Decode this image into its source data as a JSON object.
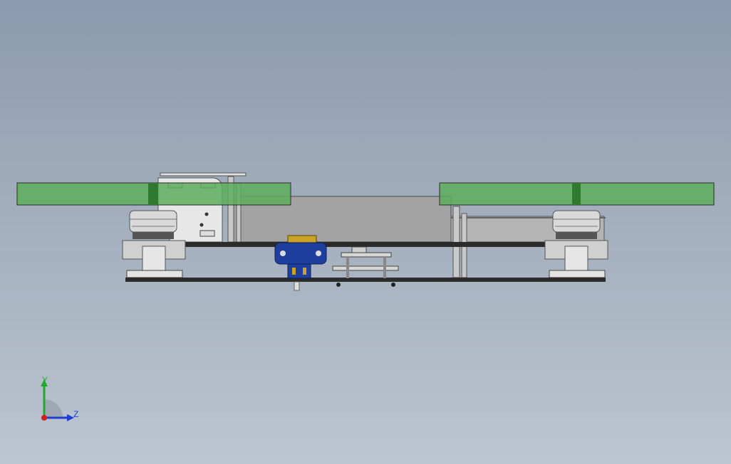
{
  "view": {
    "background_top": "#8b9aae",
    "background_bottom": "#bcc5d1"
  },
  "model": {
    "name": "quadcopter-front-view",
    "colors": {
      "propeller": "#5cae5c",
      "propeller_dark": "#2f7a2f",
      "frame_plate": "#2b2b2b",
      "housing": "#a2a2a2",
      "motor_metal": "#d9d9d9",
      "connector_blue": "#1f3f9e",
      "connector_gold": "#c9a227"
    }
  },
  "triad": {
    "y_label": "Y",
    "z_label": "Z",
    "y_color": "#1faa2c",
    "z_color": "#1f3fd0",
    "origin_color": "#d21f1f"
  }
}
